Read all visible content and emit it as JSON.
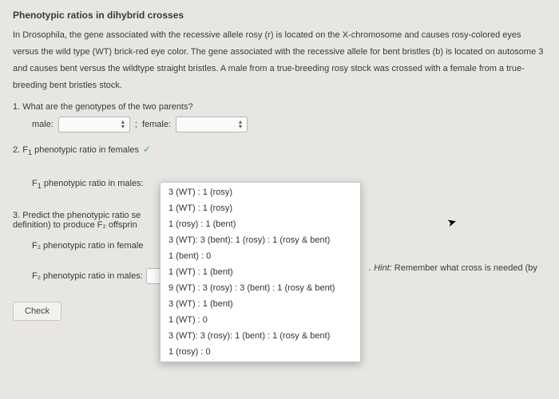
{
  "title": "Phenotypic ratios in dihybrid crosses",
  "intro": "In Drosophila, the gene associated with the recessive allele rosy (r) is located on the X-chromosome and causes rosy-colored eyes versus the wild type (WT) brick-red eye color. The gene associated with the recessive allele for bent bristles (b) is located on autosome 3 and causes bent versus the wildtype straight bristles. A male from a true-breeding rosy stock was crossed with a female from a true-breeding bent bristles stock.",
  "q1": {
    "prompt": "1. What are the genotypes of the two parents?",
    "male_label": "male:",
    "semicolon": ";",
    "female_label": "female:"
  },
  "q2": {
    "prompt_prefix": "2.  F",
    "prompt_sub": "1",
    "prompt_suffix": " phenotypic ratio in females",
    "check": "✓",
    "males_prefix": "F",
    "males_sub": "1",
    "males_suffix": " phenotypic ratio in males:"
  },
  "dropdown_options": [
    "3 (WT) : 1 (rosy)",
    "1 (WT) : 1 (rosy)",
    "1 (rosy) : 1 (bent)",
    "3 (WT): 3 (bent): 1 (rosy) : 1 (rosy & bent)",
    "1 (bent) : 0",
    "1 (WT) : 1 (bent)",
    "9 (WT) : 3 (rosy) : 3 (bent) : 1 (rosy & bent)",
    "3 (WT) : 1 (bent)",
    "1 (WT) : 0",
    "3 (WT): 3 (rosy): 1 (bent) : 1 (rosy & bent)",
    "1 (rosy) : 0"
  ],
  "q3": {
    "line1": "3. Predict the phenotypic ratio se",
    "line2": "definition) to produce F₂ offsprin",
    "f2_female": "F₂ phenotypic ratio in female",
    "f2_male": "F₂ phenotypic ratio in males:"
  },
  "hint": {
    "label": ". Hint:",
    "text": " Remember what cross is needed (by"
  },
  "check_button": "Check"
}
